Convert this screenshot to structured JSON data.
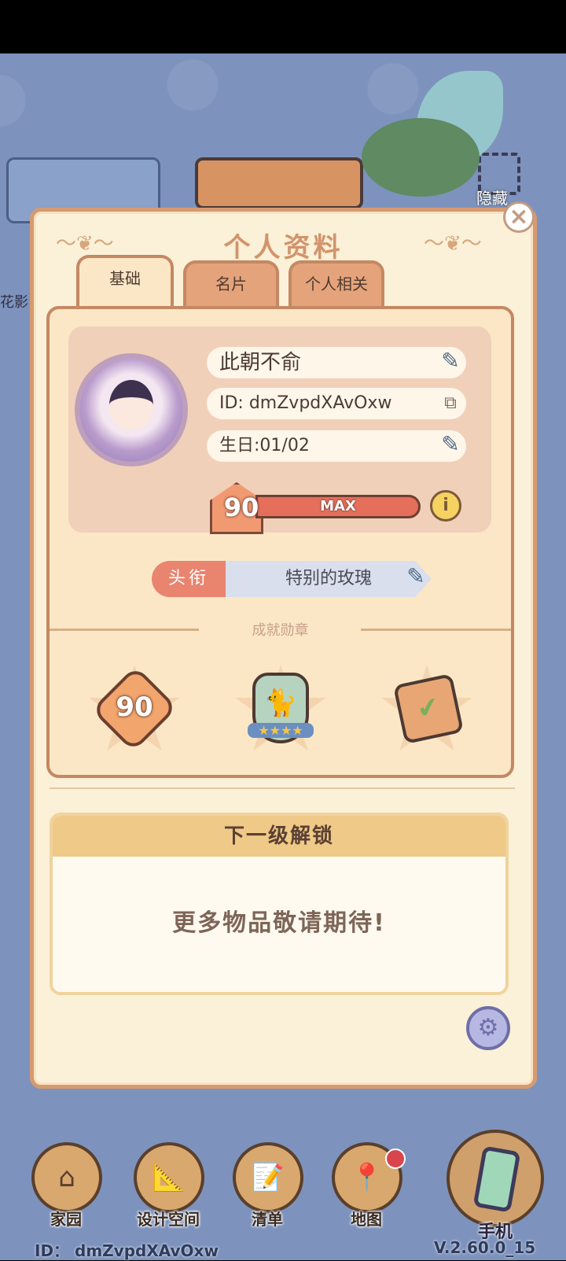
{
  "panel": {
    "title": "个人资料",
    "tabs": [
      {
        "label": "基础",
        "active": true
      },
      {
        "label": "名片",
        "active": false
      },
      {
        "label": "个人相关",
        "active": false
      }
    ]
  },
  "profile": {
    "name": "此朝不俞",
    "id_text": "ID: dmZvpdXAvOxw",
    "birthday": "生日:01/02",
    "level": "90",
    "level_status": "MAX"
  },
  "title_row": {
    "label": "头衔",
    "value": "特别的玫瑰"
  },
  "achievements": {
    "title": "成就勋章",
    "medals": [
      {
        "name": "level-90-medal",
        "text": "90"
      },
      {
        "name": "cat-star-medal",
        "text": ""
      },
      {
        "name": "calendar-check-medal",
        "text": ""
      }
    ]
  },
  "next_unlock": {
    "title": "下一级解锁",
    "message": "更多物品敬请期待!"
  },
  "bottom_nav": [
    {
      "label": "家园",
      "icon": "house-icon"
    },
    {
      "label": "设计空间",
      "icon": "ruler-pencil-icon"
    },
    {
      "label": "清单",
      "icon": "list-icon"
    },
    {
      "label": "地图",
      "icon": "map-pin-icon"
    }
  ],
  "phone": {
    "label": "手机"
  },
  "footer": {
    "id_text": "ID： dmZvpdXAvOxw",
    "version": "V.2.60.0_15"
  },
  "background": {
    "hidden_label": "隐藏",
    "side_label": "花影"
  }
}
